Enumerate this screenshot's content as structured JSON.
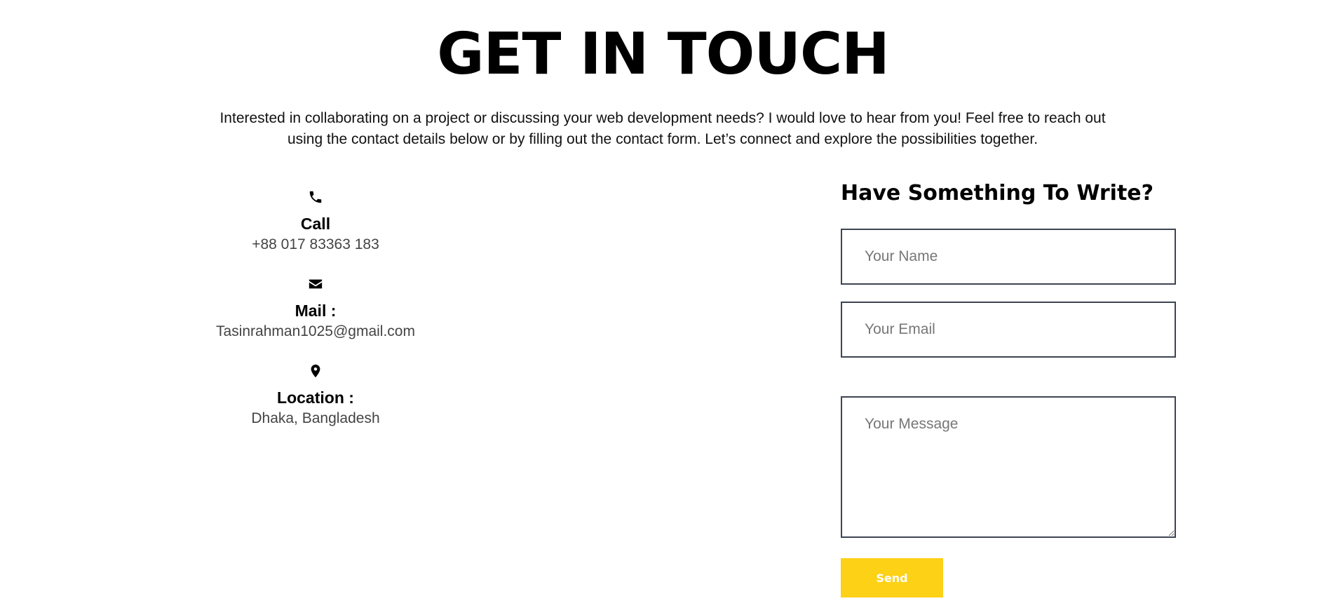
{
  "header": {
    "title": "GET IN TOUCH",
    "intro": "Interested in collaborating on a project or discussing your web development needs? I would love to hear from you! Feel free to reach out using the contact details below or by filling out the contact form. Let’s connect and explore the possibilities together."
  },
  "contact_info": {
    "call": {
      "icon": "phone-icon",
      "label": "Call",
      "value": "+88 017 83363 183"
    },
    "mail": {
      "icon": "envelope-icon",
      "label": "Mail :",
      "value": "Tasinrahman1025@gmail.com"
    },
    "location": {
      "icon": "map-pin-icon",
      "label": "Location :",
      "value": "Dhaka, Bangladesh"
    }
  },
  "form": {
    "heading": "Have Something To Write?",
    "name_placeholder": "Your Name",
    "email_placeholder": "Your Email",
    "message_placeholder": "Your Message",
    "name_value": "",
    "email_value": "",
    "message_value": "",
    "send_label": "Send"
  },
  "colors": {
    "accent": "#fcd116",
    "field_border": "#3d4452",
    "text": "#000000",
    "muted_text": "#444444"
  }
}
